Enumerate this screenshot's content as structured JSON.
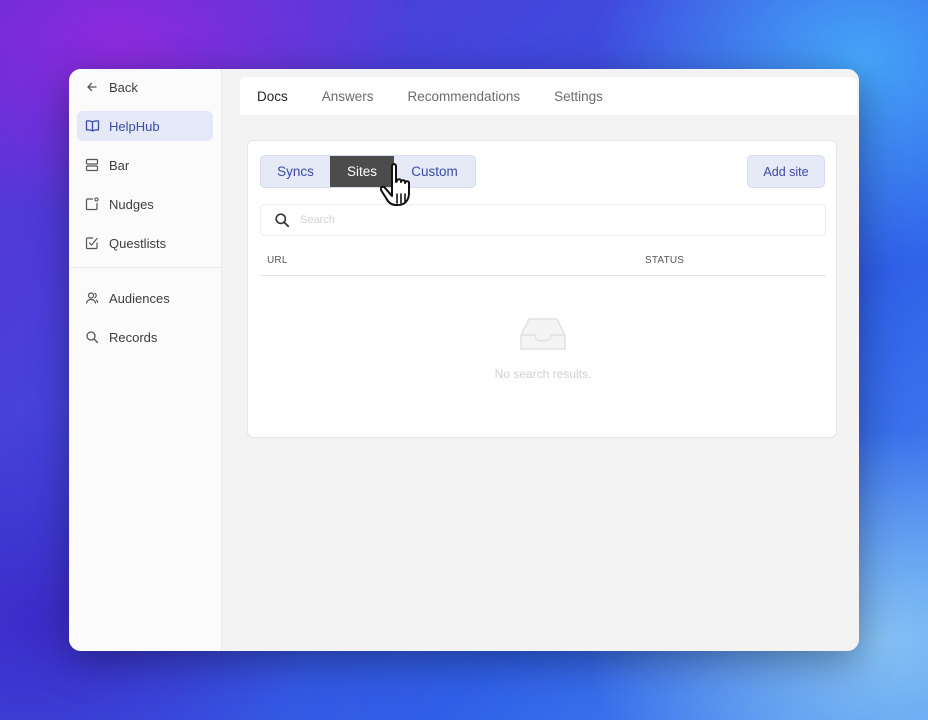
{
  "sidebar": {
    "back_label": "Back",
    "items": [
      {
        "label": "HelpHub",
        "icon": "book-icon",
        "active": true
      },
      {
        "label": "Bar",
        "icon": "bar-icon"
      },
      {
        "label": "Nudges",
        "icon": "nudge-icon"
      },
      {
        "label": "Questlists",
        "icon": "checklist-icon"
      },
      {
        "label": "Audiences",
        "icon": "users-icon"
      },
      {
        "label": "Records",
        "icon": "search-icon"
      }
    ]
  },
  "tabs": [
    "Docs",
    "Answers",
    "Recommendations",
    "Settings"
  ],
  "active_tab": "Docs",
  "segments": [
    "Syncs",
    "Sites",
    "Custom"
  ],
  "active_segment": "Sites",
  "add_button_label": "Add site",
  "search": {
    "placeholder": "Search",
    "value": ""
  },
  "table": {
    "columns": [
      "URL",
      "STATUS"
    ],
    "rows": []
  },
  "empty_message": "No search results.",
  "colors": {
    "accent": "#3a4aa8",
    "accent_bg": "#e6e9f6",
    "active_segment_bg": "#4c4c4c"
  }
}
